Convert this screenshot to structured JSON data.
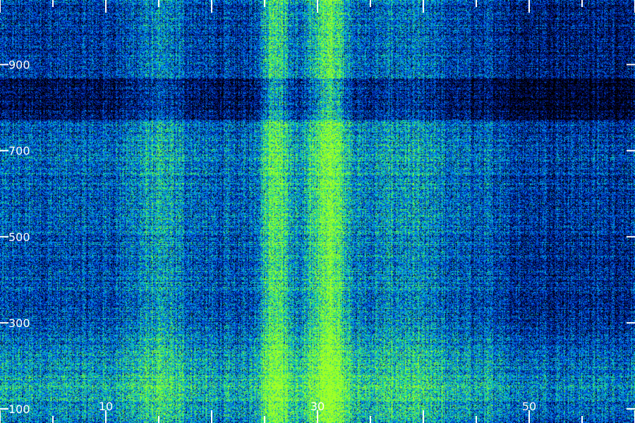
{
  "chart_data": {
    "type": "heatmap",
    "title": "",
    "xlabel": "",
    "ylabel": "",
    "xlim": [
      0,
      60
    ],
    "ylim": [
      100,
      1050
    ],
    "x_ticks": [
      {
        "value": 10,
        "label": "10"
      },
      {
        "value": 30,
        "label": "30"
      },
      {
        "value": 50,
        "label": "50"
      }
    ],
    "y_ticks": [
      {
        "value": 100,
        "label": "100"
      },
      {
        "value": 300,
        "label": "300"
      },
      {
        "value": 500,
        "label": "500"
      },
      {
        "value": 700,
        "label": "700"
      },
      {
        "value": 900,
        "label": "900"
      }
    ],
    "colormap": [
      "#000000",
      "#000a6e",
      "#0032c8",
      "#0078ff",
      "#00c8c8",
      "#3cf050",
      "#a0ff28"
    ],
    "intensity_profile": {
      "x_hotspots": [
        {
          "x": 26,
          "width": 1.5,
          "weight": 0.9
        },
        {
          "x": 31,
          "width": 2.0,
          "weight": 1.0
        },
        {
          "x": 15,
          "width": 3.0,
          "weight": 0.35
        },
        {
          "x": 38,
          "width": 4.0,
          "weight": 0.3
        }
      ],
      "y_enhance": [
        {
          "y": 150,
          "width": 120,
          "weight": 0.9
        },
        {
          "y": 550,
          "width": 200,
          "weight": 0.3
        },
        {
          "y": 700,
          "width": 80,
          "weight": 0.25
        }
      ]
    }
  }
}
